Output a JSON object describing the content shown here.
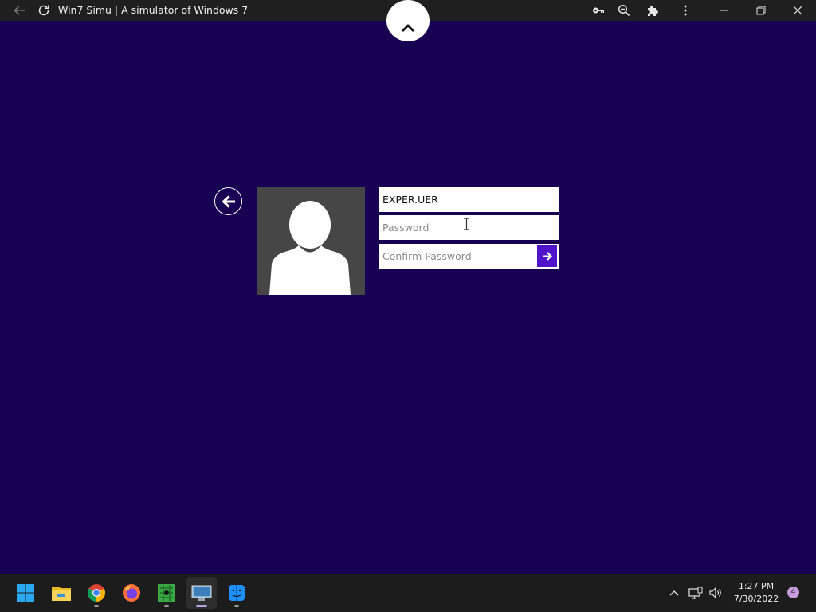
{
  "appbar": {
    "title": "Win7 Simu | A simulator of Windows 7",
    "icons": [
      "back-arrow-icon",
      "reload-icon",
      "key-icon",
      "zoom-icon",
      "extensions-icon",
      "more-icon",
      "minimize-icon",
      "restore-icon",
      "close-icon"
    ]
  },
  "login": {
    "username_value": "EXPER.UER",
    "password_placeholder": "Password",
    "confirm_placeholder": "Confirm Password"
  },
  "taskbar": {
    "apps": [
      "start",
      "file-explorer",
      "chrome",
      "firefox",
      "minesweeper",
      "win7-simu",
      "finder"
    ],
    "active_app": "win7-simu",
    "time": "1:27 PM",
    "date": "7/30/2022",
    "notification_count": "4"
  },
  "colors": {
    "background": "#180052",
    "accent": "#4f14c9",
    "appbar": "#1f1f1f",
    "taskbar": "#1c1c1c"
  }
}
